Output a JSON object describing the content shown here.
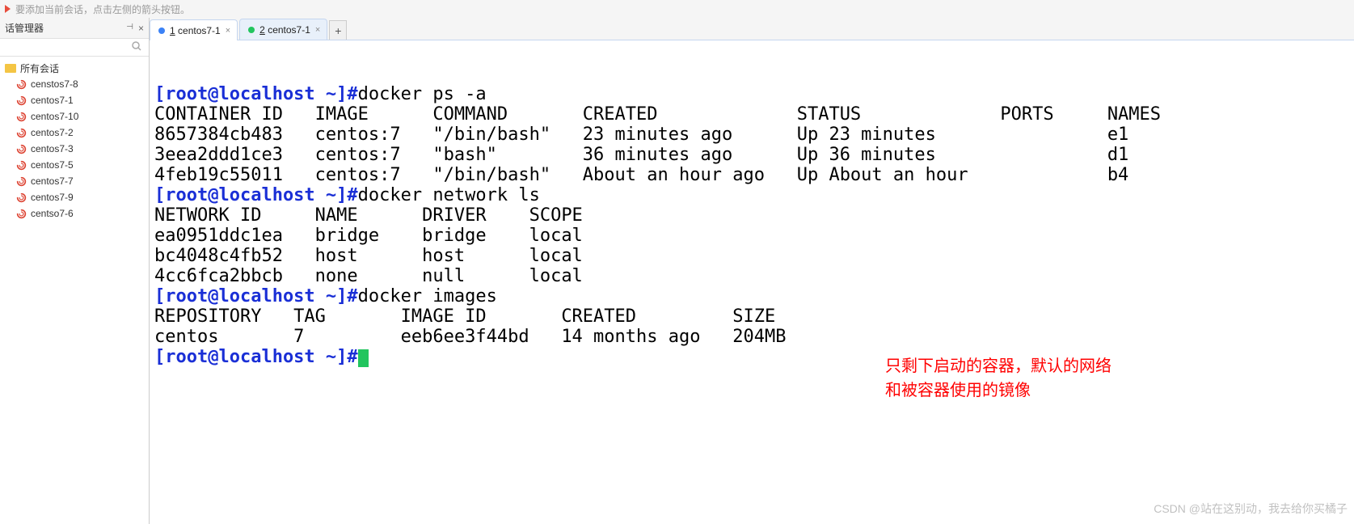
{
  "hint": "要添加当前会话，点击左侧的箭头按钮。",
  "sidebar": {
    "title": "话管理器",
    "pin_glyph": "📌",
    "close_glyph": "×",
    "search_glyph": "🔍",
    "root": "所有会话",
    "items": [
      "censtos7-8",
      "centos7-1",
      "centos7-10",
      "centos7-2",
      "centos7-3",
      "centos7-5",
      "centos7-7",
      "centos7-9",
      "centso7-6"
    ]
  },
  "tabs": {
    "items": [
      {
        "num": "1",
        "label": "centos7-1",
        "color": "blue",
        "active": true
      },
      {
        "num": "2",
        "label": "centos7-1",
        "color": "green",
        "active": false
      }
    ],
    "add": "+"
  },
  "terminal": {
    "prompt": "[root@localhost ~]#",
    "blocks": [
      {
        "cmd": "docker ps -a",
        "out": "CONTAINER ID   IMAGE      COMMAND       CREATED             STATUS             PORTS     NAMES\n8657384cb483   centos:7   \"/bin/bash\"   23 minutes ago      Up 23 minutes                e1\n3eea2ddd1ce3   centos:7   \"bash\"        36 minutes ago      Up 36 minutes                d1\n4feb19c55011   centos:7   \"/bin/bash\"   About an hour ago   Up About an hour             b4"
      },
      {
        "cmd": "docker network ls",
        "out": "NETWORK ID     NAME      DRIVER    SCOPE\nea0951ddc1ea   bridge    bridge    local\nbc4048c4fb52   host      host      local\n4cc6fca2bbcb   none      null      local"
      },
      {
        "cmd": "docker images",
        "out": "REPOSITORY   TAG       IMAGE ID       CREATED         SIZE\ncentos       7         eeb6ee3f44bd   14 months ago   204MB"
      }
    ]
  },
  "annotation": {
    "line1": "只剩下启动的容器，默认的网络",
    "line2": "和被容器使用的镜像"
  },
  "watermark": "CSDN @站在这别动，我去给你买橘子"
}
